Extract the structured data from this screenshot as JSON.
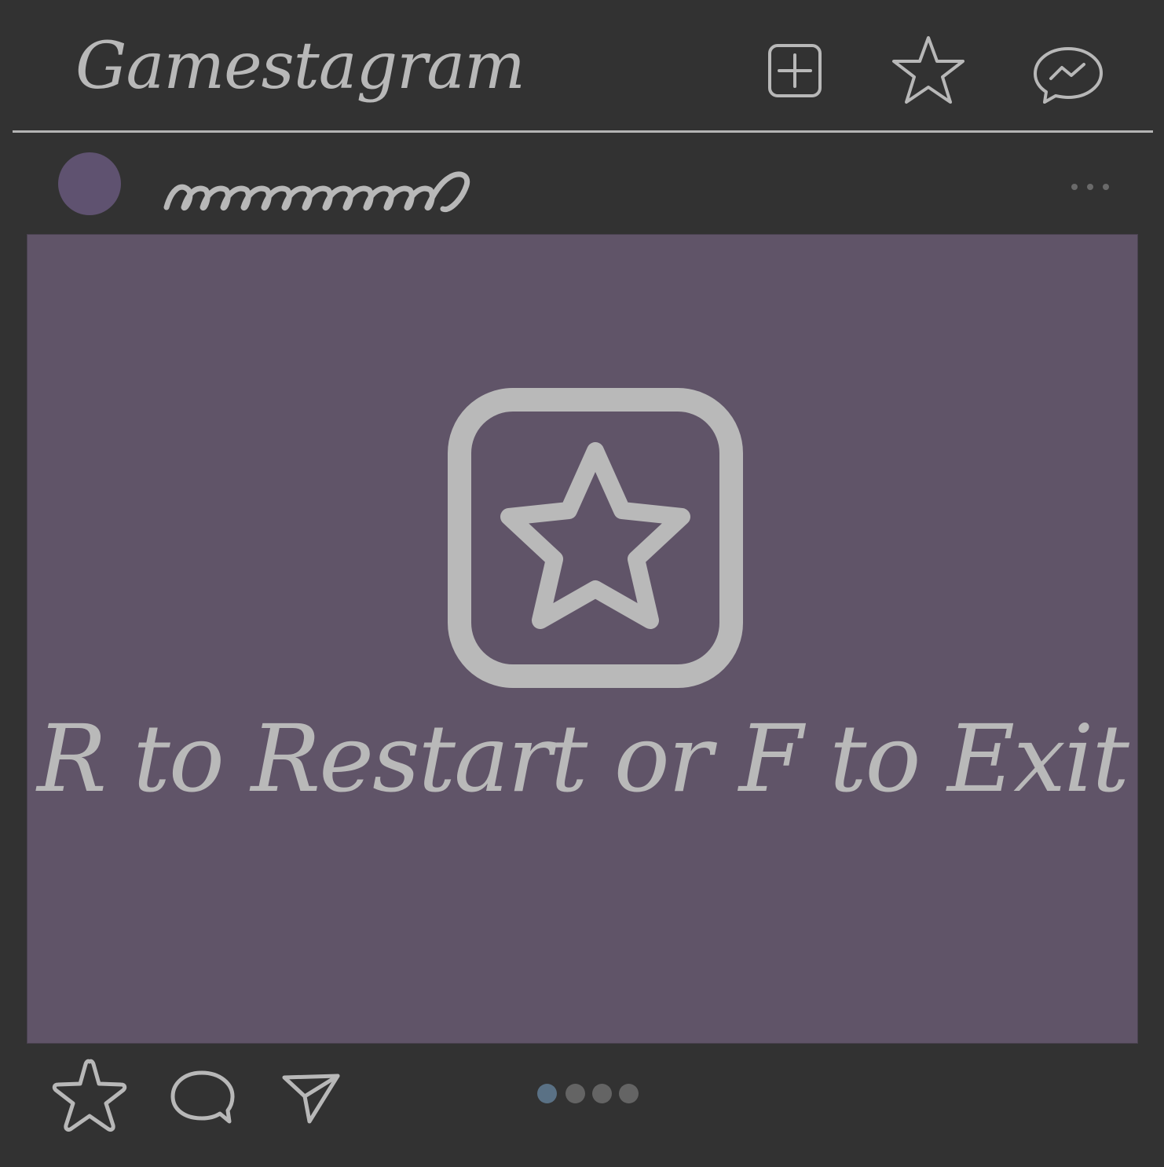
{
  "app": {
    "title": "Gamestagram"
  },
  "icons": {
    "new_post": "plus-square-icon",
    "favorites": "star-icon",
    "messages": "messenger-icon",
    "post_menu": "more-horizontal-icon",
    "center": "star-square-icon",
    "like": "star-icon",
    "comment": "speech-bubble-icon",
    "share": "paper-plane-icon"
  },
  "post": {
    "avatar_color": "#5f5270",
    "message": "R to Restart or F to Exit"
  },
  "carousel": {
    "count": 4,
    "active_index": 0,
    "active_color": "#5a7185",
    "inactive_color": "#646464"
  },
  "colors": {
    "background": "#323232",
    "post_background": "#605468",
    "icon_stroke": "#b8b8b8"
  }
}
